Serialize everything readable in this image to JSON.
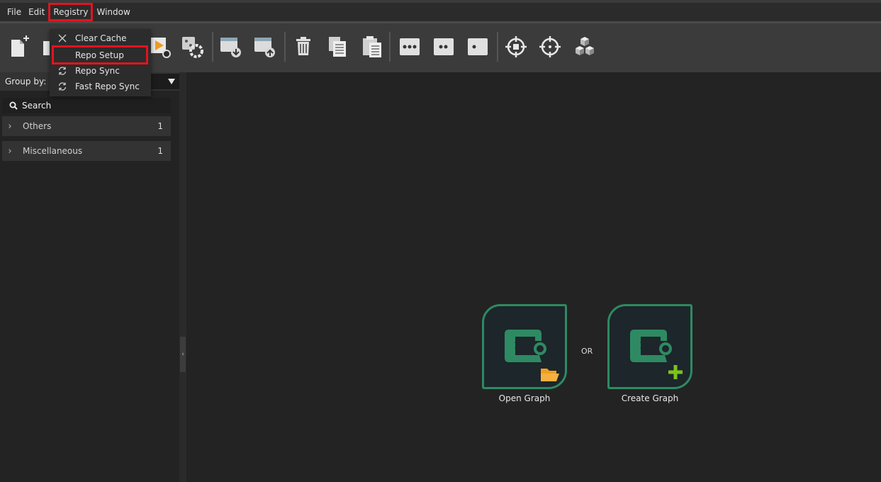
{
  "menu": {
    "items": [
      "File",
      "Edit",
      "Registry",
      "Window"
    ],
    "active": "Registry"
  },
  "registry_menu": {
    "items": [
      {
        "label": "Clear Cache",
        "icon": "close-icon"
      },
      {
        "label": "Repo Setup",
        "icon": "",
        "highlighted": true
      },
      {
        "label": "Repo Sync",
        "icon": "sync-icon"
      },
      {
        "label": "Fast Repo Sync",
        "icon": "sync-icon"
      }
    ]
  },
  "toolbar": {
    "icons": [
      "new-file-icon",
      "open-folder-icon",
      "run-icon",
      "settings-icon",
      "download-icon",
      "upload-icon",
      "delete-icon",
      "copy-icon",
      "paste-icon",
      "three-dots-icon",
      "two-dots-icon",
      "one-dot-icon",
      "target-icon",
      "crosshair-icon",
      "cubes-icon"
    ]
  },
  "left_panel": {
    "group_by_label": "Group by:",
    "group_by_value": "",
    "search_label": "Search",
    "categories": [
      {
        "name": "Others",
        "count": "1"
      },
      {
        "name": "Miscellaneous",
        "count": "1"
      }
    ]
  },
  "splitter_glyph": "‹",
  "canvas": {
    "open_graph_label": "Open Graph",
    "or_label": "OR",
    "create_graph_label": "Create Graph"
  },
  "colors": {
    "accent_green": "#2e8a63",
    "highlight_red": "#e0141e",
    "folder_orange": "#f0a020",
    "plus_green": "#7ac41e"
  }
}
